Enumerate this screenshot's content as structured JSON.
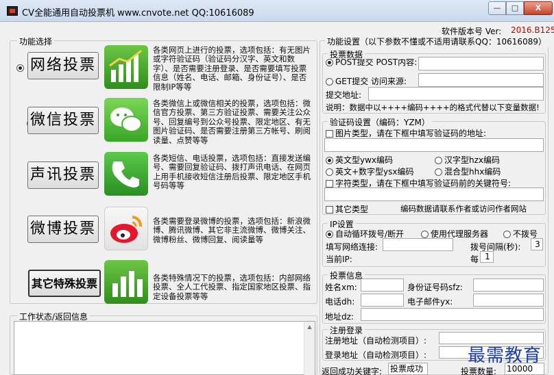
{
  "window": {
    "title": "CV全能通用自动投票机  www.cnvote.net  QQ:10616089",
    "min_label": "—",
    "max_label": "□",
    "close_label": "X"
  },
  "version": {
    "label": "软件版本号 Ver:",
    "value": "2016.B125",
    "value_color": "#cc0000"
  },
  "left": {
    "legend": "功能选择",
    "options": [
      {
        "label": "网络投票",
        "selected": true,
        "icon": "chart-icon",
        "desc": "各类网页上进行的投票，选项包括：有无图片或字符验证码（验证码分汉字、英文和数字）、是否需要注册登录、是否需要填写投票信息（姓名、电话、邮箱、身份证号）、是否限制IP等等"
      },
      {
        "label": "微信投票",
        "selected": false,
        "icon": "wechat-icon",
        "desc": "各类微信上或微信相关的投票，选项包括：微信官方投票、第三方验证投票、需要关注公众号、回复编号到公众号投票、限定地区、有无图片验证码、是否需要注册第三方帐号、刷阅读量、点赞等等"
      },
      {
        "label": "声讯投票",
        "selected": false,
        "icon": "phone-icon",
        "desc": "各类短信、电话投票，选项包括：直接发送编号、需要回复验证码、拨打声讯电话、在网页上用手机接收短信注册后投票、限定地区手机号码等等"
      },
      {
        "label": "微博投票",
        "selected": false,
        "icon": "weibo-icon",
        "desc": "各类需要登录微博的投票，选项包括：新浪微博、腾讯微博、其它非主流微博、微博关注、微博粉丝、微博回复、阅读量等"
      },
      {
        "label": "其它特殊投票",
        "selected": false,
        "icon": "bar-chart-icon",
        "desc": "各类特殊情况下的投票，选项包括：内部网络投票、全人工代投票、指定国家地区投票、指定设备投票等等"
      }
    ],
    "status_legend": "工作状态/返回信息"
  },
  "right": {
    "legend": "功能设置（以下参数不懂或不适用请联系QQ：10616089）",
    "vote_data": {
      "legend": "投票数据",
      "post_label": "POST提交 POST内容:",
      "get_label": "GET提交 访问来源:",
      "url_label": "提交地址:",
      "note": "说明：数据中以++++编码++++的格式代替以下变量数据!"
    },
    "captcha": {
      "legend": "验证码设置（编码：YZM）",
      "image_label": "图片类型，请在下框中填写验证码的地址:",
      "opt_en": "英文型ywx编码",
      "opt_cn": "汉字型hzx编码",
      "opt_ennum": "英文+数字型ysx编码",
      "opt_mix": "混合型hhx编码",
      "char_label": "字符类型，请在下框中填写验证码前的关键符号:",
      "other_label": "其它类型",
      "other_note": "编码数据请联系作者或访问作者网站"
    },
    "ip": {
      "legend": "IP设置",
      "opt_auto": "自动循环拨号/断开",
      "opt_proxy": "使用代理服务器",
      "opt_none": "不拨号",
      "conn_label": "填写网络连接:",
      "interval_label": "拨号间隔(秒):",
      "interval_value": "3",
      "current_ip_label": "当前IP:",
      "per_label": "每",
      "per_value": "1"
    },
    "vote_info": {
      "legend": "投票信息",
      "name_label": "姓名xm:",
      "id_label": "身份证号码sfz:",
      "phone_label": "电话dh:",
      "email_label": "电子邮件yx:",
      "addr_label": "地址dz:"
    },
    "register": {
      "legend": "注册登录",
      "reg_label": "注册地址（自动检测项目）:",
      "login_label": "登录地址（自动检测项目）:"
    },
    "success_label": "返回成功关键字:",
    "success_value": "投票成功",
    "count_label": "投票数量:",
    "count_value": "10000"
  },
  "watermark": "最需教育"
}
